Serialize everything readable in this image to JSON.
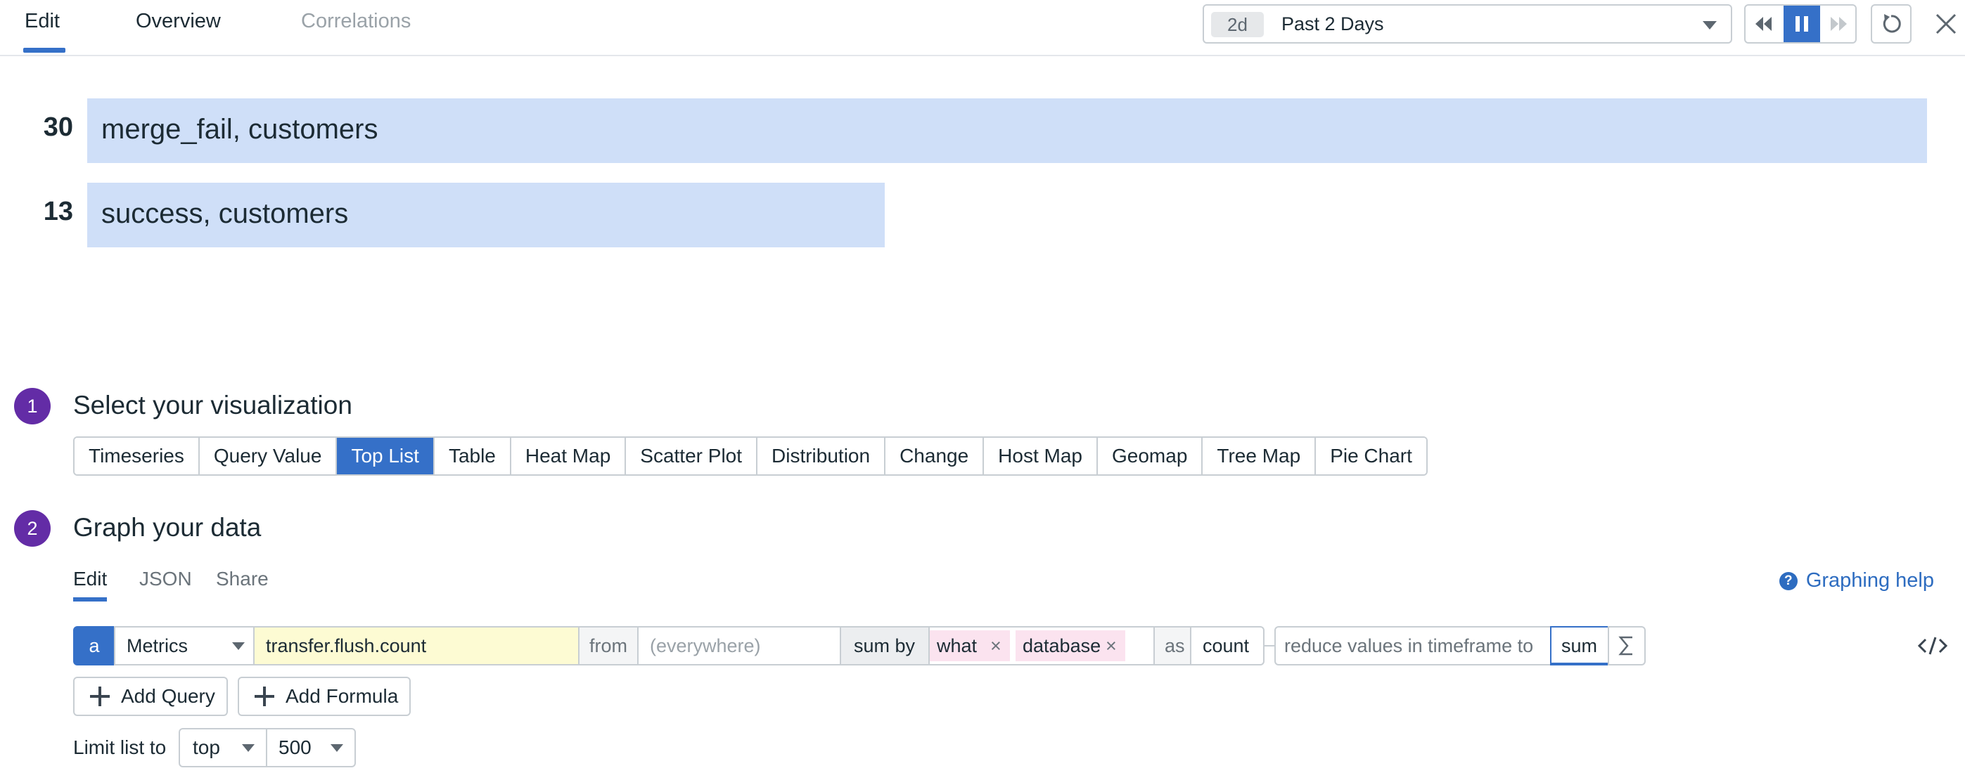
{
  "tabs": {
    "edit": "Edit",
    "overview": "Overview",
    "correlations": "Correlations"
  },
  "time_selector": {
    "shortcut": "2d",
    "label": "Past 2 Days"
  },
  "toplist": [
    {
      "value": "30",
      "label": "merge_fail, customers",
      "fraction": 1.0
    },
    {
      "value": "13",
      "label": "success, customers",
      "fraction": 0.4333
    }
  ],
  "step1": {
    "number": "1",
    "title": "Select your visualization"
  },
  "visualizations": [
    "Timeseries",
    "Query Value",
    "Top List",
    "Table",
    "Heat Map",
    "Scatter Plot",
    "Distribution",
    "Change",
    "Host Map",
    "Geomap",
    "Tree Map",
    "Pie Chart"
  ],
  "active_visualization": "Top List",
  "step2": {
    "number": "2",
    "title": "Graph your data"
  },
  "subtabs": {
    "edit": "Edit",
    "json": "JSON",
    "share": "Share"
  },
  "graphing_help": "Graphing help",
  "query": {
    "letter": "a",
    "source": "Metrics",
    "metric": "transfer.flush.count",
    "from_label": "from",
    "from_placeholder": "(everywhere)",
    "sum_by_label": "sum by",
    "group_by": [
      "what",
      "database"
    ],
    "as_label": "as",
    "as_value": "count",
    "reduce_label": "reduce values in timeframe to",
    "reduce_value": "sum"
  },
  "buttons": {
    "add_query": "Add Query",
    "add_formula": "Add Formula"
  },
  "limit": {
    "label": "Limit list to",
    "direction": "top",
    "count": "500"
  },
  "colors": {
    "accent": "#3570c8",
    "bar": "#cfdff8",
    "step_badge": "#632ca6",
    "metric_field": "#fdfbd3",
    "tag_chip": "#fbe3ef"
  }
}
